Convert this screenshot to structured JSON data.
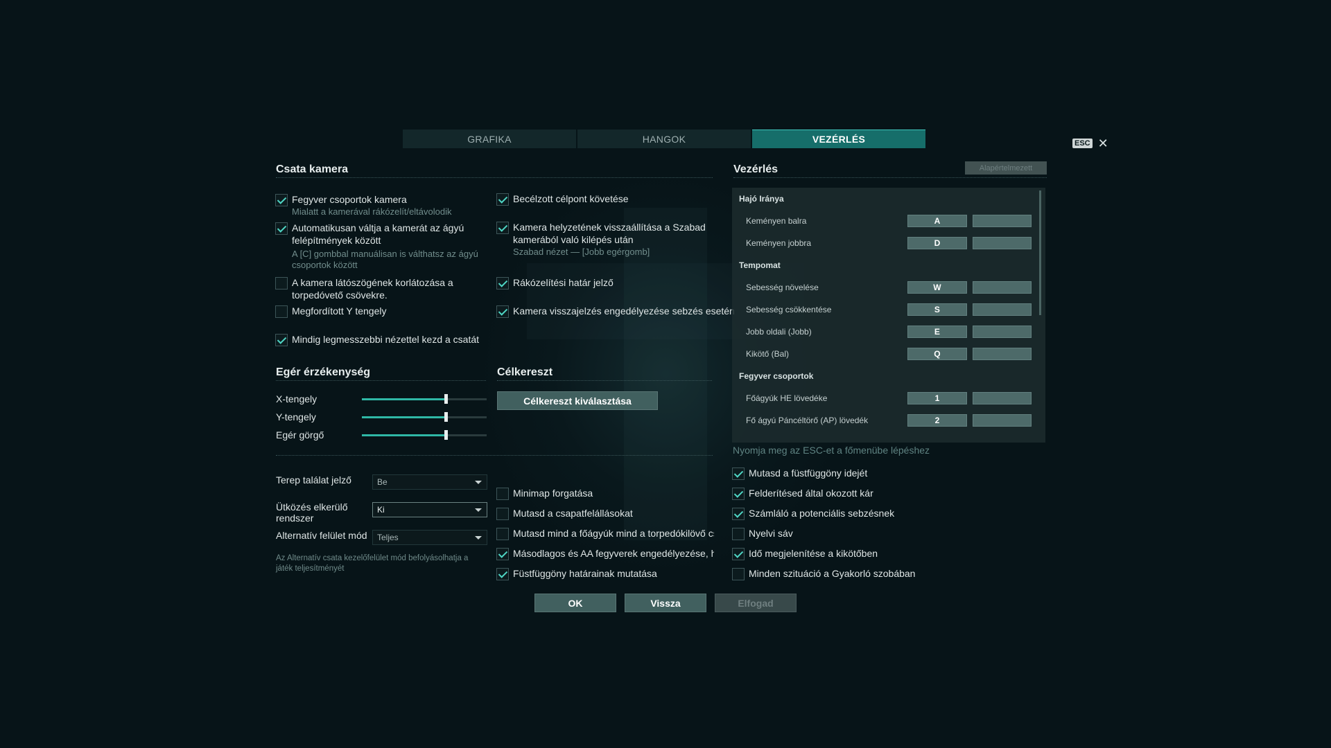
{
  "tabs": [
    {
      "label": "GRAFIKA"
    },
    {
      "label": "HANGOK"
    },
    {
      "label": "VEZÉRLÉS"
    }
  ],
  "esc_badge": "ESC",
  "close_symbol": "✕",
  "camera": {
    "title": "Csata kamera",
    "left": [
      {
        "label": "Fegyver csoportok kamera",
        "sub": "Mialatt a kamerával rákózelít/eltávolodik",
        "checked": true
      },
      {
        "label": "Automatikusan váltja a kamerát az ágyú felépítmények között",
        "sub": "A [C] gombbal manuálisan is válthatsz az ágyú csoportok között",
        "checked": true
      },
      {
        "label": "A kamera látószögének korlátozása a torpedóvető csövekre.",
        "sub": "",
        "checked": false
      },
      {
        "label": "Megfordított Y tengely",
        "sub": "",
        "checked": false
      },
      {
        "label": "Mindig legmesszebbi nézettel kezd a csatát",
        "sub": "",
        "checked": true
      }
    ],
    "right": [
      {
        "label": "Becélzott célpont követése",
        "sub": "",
        "checked": true
      },
      {
        "label": "Kamera helyzetének visszaállítása a Szabad kamerából való kilépés után",
        "sub": "Szabad nézet — [Jobb egérgomb]",
        "checked": true
      },
      {
        "label": "Rákózelítési határ jelző",
        "sub": "",
        "checked": true
      },
      {
        "label": "Kamera visszajelzés engedélyezése sebzés esetén",
        "sub": "",
        "checked": true
      }
    ]
  },
  "mouse": {
    "title": "Egér érzékenység",
    "sliders": [
      {
        "label": "X-tengely",
        "value": 0.67
      },
      {
        "label": "Y-tengely",
        "value": 0.67
      },
      {
        "label": "Egér görgő",
        "value": 0.67
      }
    ]
  },
  "crosshair": {
    "title": "Célkereszt",
    "button": "Célkereszt kiválasztása"
  },
  "dropdowns": [
    {
      "label": "Terep találat jelző",
      "value": "Be"
    },
    {
      "label": "Ütközés elkerülő rendszer",
      "value": "Ki"
    },
    {
      "label": "Alternatív felület mód",
      "value": "Teljes"
    }
  ],
  "alt_note": "Az Alternatív csata kezelőfelület mód befolyásolhatja a játék teljesítményét",
  "mid_checks": [
    {
      "label": "Minimap forgatása",
      "checked": false
    },
    {
      "label": "Mutasd a csapatfelállásokat",
      "checked": false
    },
    {
      "label": "Mutasd mind a főágyúk mind a torpedókilövő csöve",
      "checked": false
    },
    {
      "label": "Másodlagos és AA fegyverek engedélyezése, ha els",
      "checked": true
    },
    {
      "label": "Füstfüggöny határainak mutatása",
      "checked": true
    }
  ],
  "right_checks": [
    {
      "label": "Mutasd a füstfüggöny idejét",
      "checked": true
    },
    {
      "label": "Felderítésed által okozott kár",
      "checked": true
    },
    {
      "label": "Számláló a potenciális sebzésnek",
      "checked": true
    },
    {
      "label": "Nyelvi sáv",
      "checked": false
    },
    {
      "label": "Idő megjelenítése a kikötőben",
      "checked": true
    },
    {
      "label": "Minden szituáció a Gyakorló szobában",
      "checked": false
    }
  ],
  "controls": {
    "title": "Vezérlés",
    "reset": "Alapértelmezett",
    "esc_hint": "Nyomja meg az ESC-et a főmenübe lépéshez",
    "rows": [
      {
        "type": "category",
        "label": "Hajó Iránya"
      },
      {
        "type": "bind",
        "label": "Keményen balra",
        "key": "A",
        "alt": ""
      },
      {
        "type": "bind",
        "label": "Keményen jobbra",
        "key": "D",
        "alt": ""
      },
      {
        "type": "category",
        "label": "Tempomat"
      },
      {
        "type": "bind",
        "label": "Sebesség növelése",
        "key": "W",
        "alt": ""
      },
      {
        "type": "bind",
        "label": "Sebesség csökkentése",
        "key": "S",
        "alt": ""
      },
      {
        "type": "bind",
        "label": "Jobb oldali (Jobb)",
        "key": "E",
        "alt": ""
      },
      {
        "type": "bind",
        "label": "Kikötő (Bal)",
        "key": "Q",
        "alt": ""
      },
      {
        "type": "category",
        "label": "Fegyver csoportok"
      },
      {
        "type": "bind",
        "label": "Főágyúk HE lövedéke",
        "key": "1",
        "alt": ""
      },
      {
        "type": "bind",
        "label": "Fő ágyú Páncéltörő (AP) lövedék",
        "key": "2",
        "alt": ""
      }
    ]
  },
  "footer": {
    "ok": "OK",
    "back": "Vissza",
    "accept": "Elfogad"
  }
}
